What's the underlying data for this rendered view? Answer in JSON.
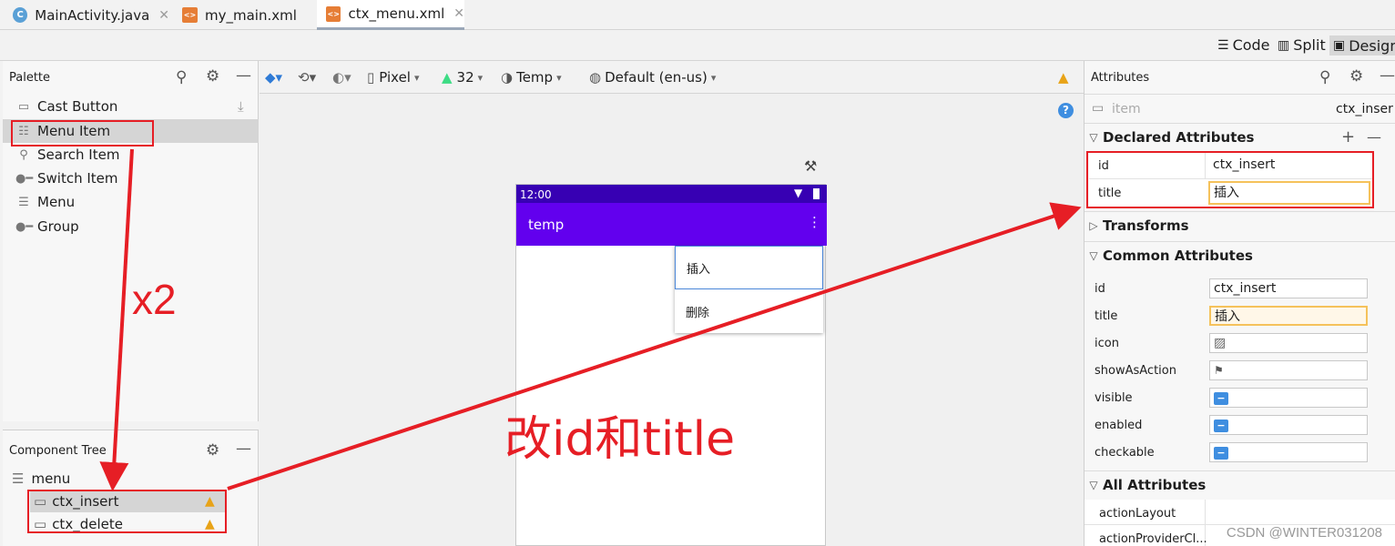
{
  "tabs": [
    {
      "label": "MainActivity.java",
      "icon": "java-class-icon"
    },
    {
      "label": "my_main.xml",
      "icon": "xml-file-icon"
    },
    {
      "label": "ctx_menu.xml",
      "icon": "xml-file-icon",
      "active": true
    }
  ],
  "view_modes": {
    "code": "Code",
    "split": "Split",
    "design": "Design"
  },
  "palette": {
    "title": "Palette",
    "items": [
      "Cast Button",
      "Menu Item",
      "Search Item",
      "Switch Item",
      "Menu",
      "Group"
    ],
    "selected": "Menu Item"
  },
  "component_tree": {
    "title": "Component Tree",
    "root": "menu",
    "children": [
      "ctx_insert",
      "ctx_delete"
    ]
  },
  "design_toolbar": {
    "device": "Pixel",
    "api": "32",
    "theme": "Temp",
    "locale": "Default (en-us)"
  },
  "phone": {
    "time": "12:00",
    "app_title": "temp",
    "menu_items": [
      "插入",
      "删除"
    ]
  },
  "attributes": {
    "title": "Attributes",
    "element_type": "item",
    "element_id": "ctx_inser",
    "declared": {
      "header": "Declared Attributes",
      "rows": [
        {
          "label": "id",
          "value": "ctx_insert"
        },
        {
          "label": "title",
          "value": "插入"
        }
      ]
    },
    "transforms": "Transforms",
    "common": {
      "header": "Common Attributes",
      "rows": [
        {
          "label": "id",
          "value": "ctx_insert"
        },
        {
          "label": "title",
          "value": "插入"
        },
        {
          "label": "icon",
          "value": ""
        },
        {
          "label": "showAsAction",
          "value": ""
        },
        {
          "label": "visible",
          "value": ""
        },
        {
          "label": "enabled",
          "value": ""
        },
        {
          "label": "checkable",
          "value": ""
        }
      ]
    },
    "all": {
      "header": "All Attributes",
      "rows": [
        {
          "label": "actionLayout"
        },
        {
          "label": "actionProviderCl..."
        }
      ]
    }
  },
  "annotations": {
    "x2": "x2",
    "change_label": "改id和title",
    "color": "#e61e25"
  },
  "watermark": "CSDN @WINTER031208"
}
